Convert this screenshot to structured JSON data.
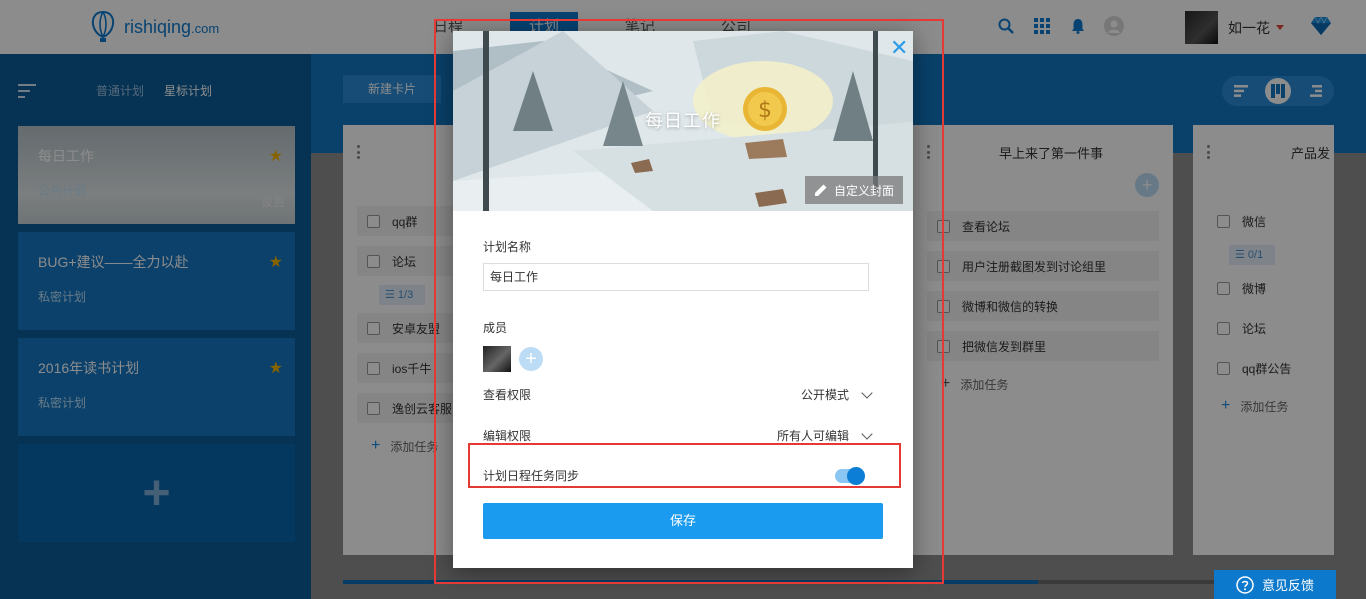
{
  "header": {
    "logo_text": "rishiqing",
    "logo_suffix": ".com",
    "nav": [
      "日程",
      "计划",
      "笔记",
      "公司"
    ],
    "user_name": "如一花"
  },
  "sidebar": {
    "tabs": [
      "普通计划",
      "星标计划"
    ],
    "plans": [
      {
        "title": "每日工作",
        "subtitle": "公共计划",
        "extra": "设置"
      },
      {
        "title": "BUG+建议——全力以赴",
        "subtitle": "私密计划"
      },
      {
        "title": "2016年读书计划",
        "subtitle": "私密计划"
      }
    ],
    "add_symbol": "+"
  },
  "toolbar": {
    "new_card": "新建卡片"
  },
  "columns": [
    {
      "title": "",
      "tasks": [
        "qq群",
        "论坛",
        "安卓友盟",
        "ios千牛",
        "逸创云客服"
      ],
      "sub_badge": "1/3",
      "add_label": "添加任务"
    },
    {
      "title": "早上来了第一件事",
      "tasks": [
        "查看论坛",
        "用户注册截图发到讨论组里",
        "微博和微信的转换",
        "把微信发到群里"
      ],
      "add_label": "添加任务"
    },
    {
      "title": "产品发",
      "tasks": [
        "微信",
        "微博",
        "论坛",
        "qq群公告"
      ],
      "sub_badge": "0/1",
      "add_label": "添加任务"
    }
  ],
  "feedback": "意见反馈",
  "modal": {
    "cover_title": "每日工作",
    "custom_cover": "自定义封面",
    "name_label": "计划名称",
    "name_value": "每日工作",
    "members_label": "成员",
    "view_perm_label": "查看权限",
    "view_perm_value": "公开模式",
    "edit_perm_label": "编辑权限",
    "edit_perm_value": "所有人可编辑",
    "sync_label": "计划日程任务同步",
    "sync_on": true,
    "save": "保存"
  },
  "colors": {
    "accent": "#1a9bf0",
    "brand": "#0e7bd0",
    "highlight": "#e53935",
    "star": "#f4b400"
  }
}
